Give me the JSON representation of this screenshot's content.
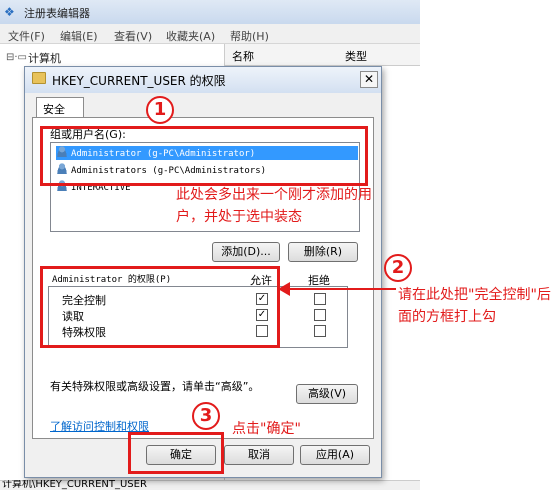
{
  "registry": {
    "title": "注册表编辑器",
    "menu": [
      "文件(F)",
      "编辑(E)",
      "查看(V)",
      "收藏夹(A)",
      "帮助(H)"
    ],
    "tree_root": "计算机",
    "columns": {
      "name": "名称",
      "type": "类型"
    },
    "status_path": "计算机\\HKEY_CURRENT_USER"
  },
  "dialog": {
    "title": "HKEY_CURRENT_USER 的权限",
    "close": "✕",
    "tab": "安全",
    "group_label": "组或用户名(G):",
    "users": [
      "Administrator (g-PC\\Administrator)",
      "Administrators (g-PC\\Administrators)",
      "INTERACTIVE"
    ],
    "add_button": "添加(D)...",
    "remove_button": "删除(R)",
    "perm_header": "Administrator 的权限(P)",
    "allow_header": "允许",
    "deny_header": "拒绝",
    "permissions": [
      {
        "name": "完全控制",
        "allow": "✓",
        "deny": ""
      },
      {
        "name": "读取",
        "allow": "✓",
        "deny": ""
      },
      {
        "name": "特殊权限",
        "allow": "",
        "deny": ""
      }
    ],
    "special_note": "有关特殊权限或高级设置，请单击“高级”。",
    "advanced_button": "高级(V)",
    "help_link": "了解访问控制和权限",
    "ok_button": "确定",
    "cancel_button": "取消",
    "apply_button": "应用(A)"
  },
  "annotations": {
    "step1": "1",
    "step2": "2",
    "step3": "3",
    "note1": "此处会多出来一个刚才添加的用户，并处于选中装态",
    "note2": "请在此处把\"完全控制\"后面的方框打上勾",
    "note3": "点击\"确定\"",
    "color": "#e21b1b"
  }
}
